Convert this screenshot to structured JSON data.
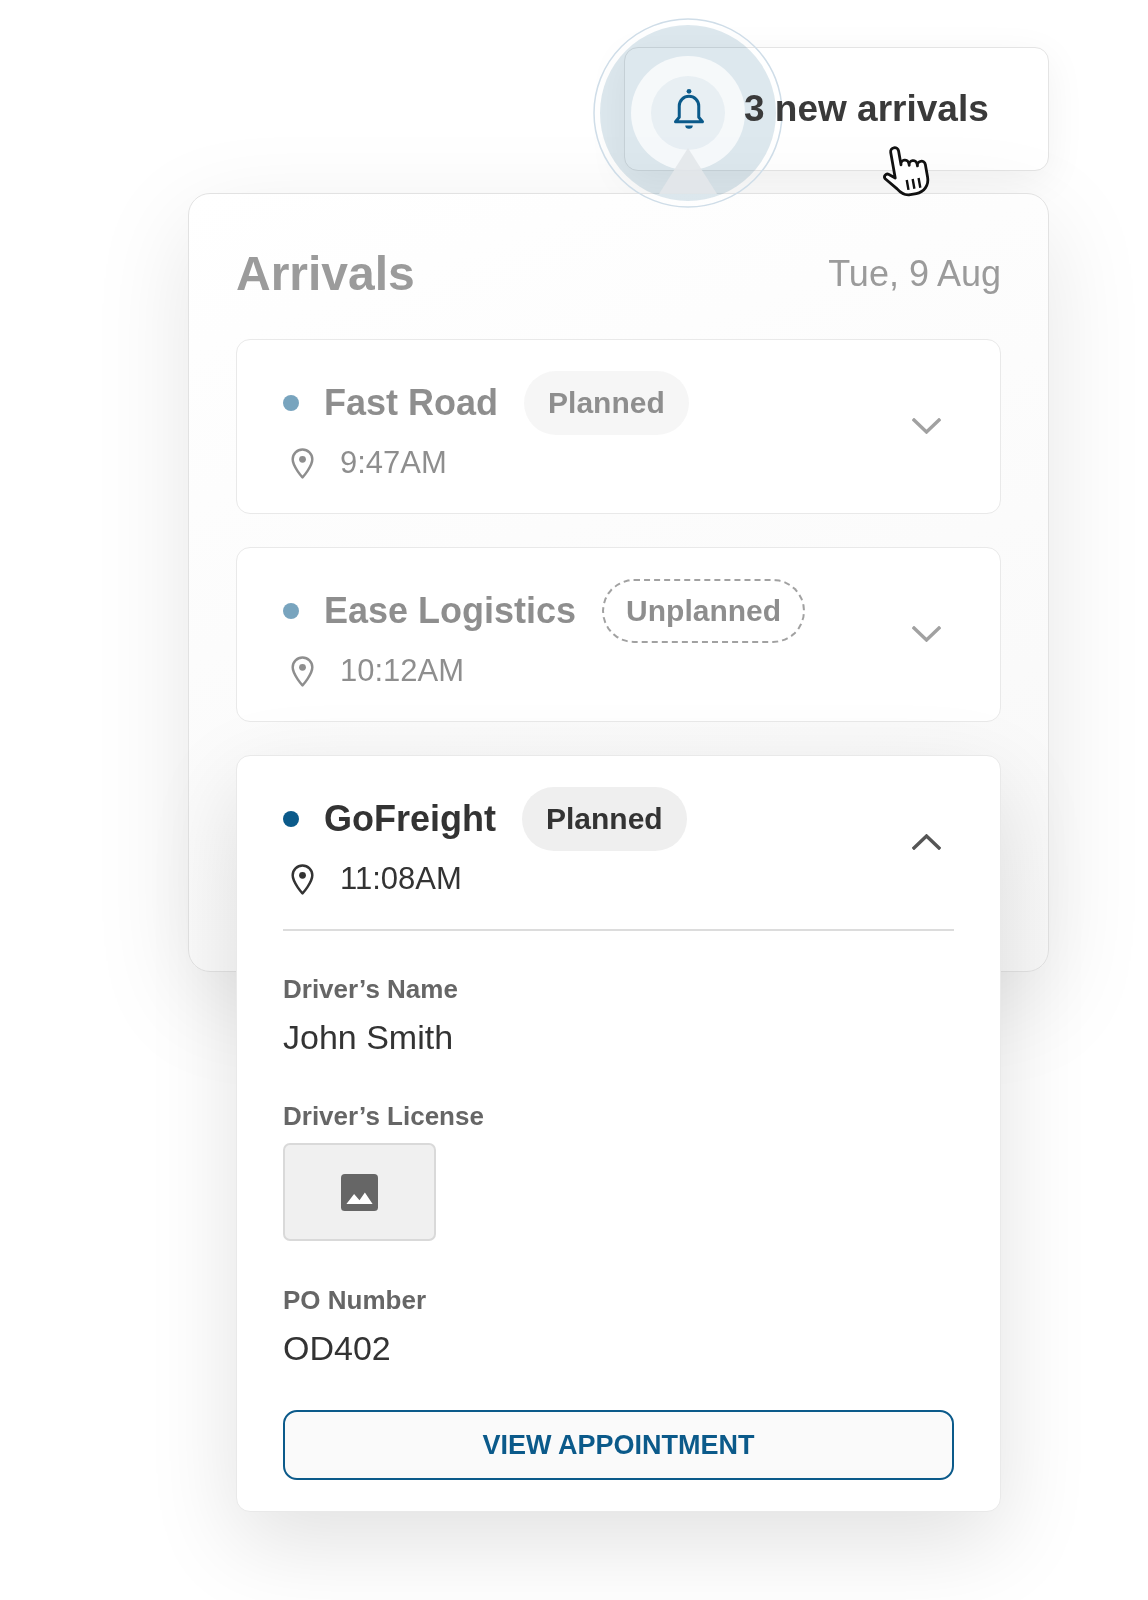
{
  "notification": {
    "label": "3 new arrivals"
  },
  "panel": {
    "title": "Arrivals",
    "date": "Tue, 9 Aug"
  },
  "arrivals": [
    {
      "carrier": "Fast Road",
      "badge": {
        "label": "Planned",
        "kind": "filled"
      },
      "time": "9:47AM",
      "expanded": false
    },
    {
      "carrier": "Ease Logistics",
      "badge": {
        "label": "Unplanned",
        "kind": "dashed"
      },
      "time": "10:12AM",
      "expanded": false
    },
    {
      "carrier": "GoFreight",
      "badge": {
        "label": "Planned",
        "kind": "filled"
      },
      "time": "11:08AM",
      "expanded": true,
      "details": [
        {
          "kind": "text",
          "label": "Driver’s Name",
          "value": "John Smith"
        },
        {
          "kind": "image",
          "label": "Driver’s License"
        },
        {
          "kind": "text",
          "label": "PO Number",
          "value": "OD402"
        }
      ],
      "action": "VIEW APPOINTMENT"
    }
  ]
}
